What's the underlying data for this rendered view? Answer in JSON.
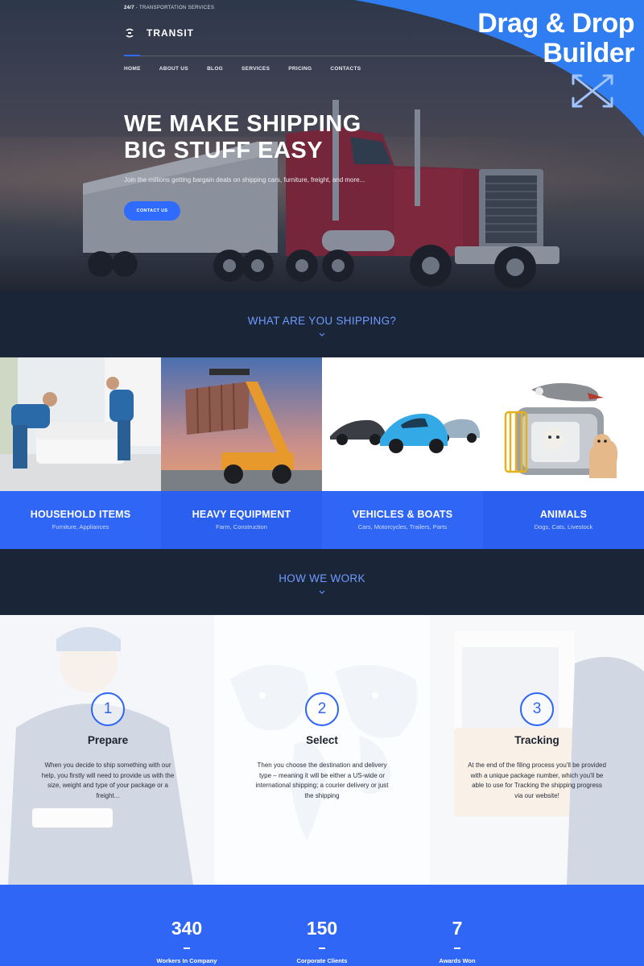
{
  "header": {
    "topline_strong": "24/7",
    "topline_rest": " - TRANSPORTATION SERVICES",
    "logo_text": "TRANSIT"
  },
  "nav": [
    {
      "label": "HOME",
      "active": true
    },
    {
      "label": "ABOUT US"
    },
    {
      "label": "BLOG"
    },
    {
      "label": "SERVICES"
    },
    {
      "label": "PRICING"
    },
    {
      "label": "CONTACTS"
    }
  ],
  "hero": {
    "title_line1": "WE MAKE SHIPPING",
    "title_line2": "BIG STUFF EASY",
    "subtitle": "Join the millions getting bargain deals on shipping cars, furniture, freight, and more...",
    "cta": "CONTACT US"
  },
  "badge": {
    "line1": "Drag & Drop",
    "line2": "Builder",
    "icon": "move-arrows-icon"
  },
  "shipping": {
    "heading": "WHAT ARE YOU SHIPPING?",
    "categories": [
      {
        "title": "HOUSEHOLD ITEMS",
        "subtitle": "Furniture, Appliances",
        "image": "movers-carrying-sofa"
      },
      {
        "title": "HEAVY EQUIPMENT",
        "subtitle": "Farm, Construction",
        "image": "container-loader"
      },
      {
        "title": "VEHICLES & BOATS",
        "subtitle": "Cars, Motorcycles, Trailers, Parts",
        "image": "sports-cars"
      },
      {
        "title": "ANIMALS",
        "subtitle": "Dogs, Cats, Livestock",
        "image": "pets-carrier"
      }
    ]
  },
  "work": {
    "heading": "HOW WE WORK",
    "steps": [
      {
        "number": "1",
        "title": "Prepare",
        "text": "When you decide to ship something with our help, you firstly will need to provide us with the size, weight and type of your package or a freight..."
      },
      {
        "number": "2",
        "title": "Select",
        "text": "Then you choose the destination and delivery type – meaning it will be either a US-wide or international shipping; a courier delivery or just the shipping"
      },
      {
        "number": "3",
        "title": "Tracking",
        "text": "At the end of the filing process you'll be provided with a unique package number, which you'll be able to use for Tracking the shipping progress via our website!"
      }
    ]
  },
  "stats": [
    {
      "number": "340",
      "label": "Workers In Company"
    },
    {
      "number": "150",
      "label": "Corporate Clients"
    },
    {
      "number": "7",
      "label": "Awards Won"
    }
  ],
  "colors": {
    "accent": "#2f66f5",
    "dark_band": "#1b2538",
    "band_title": "#6f9cff",
    "badge": "#2f7df0"
  }
}
